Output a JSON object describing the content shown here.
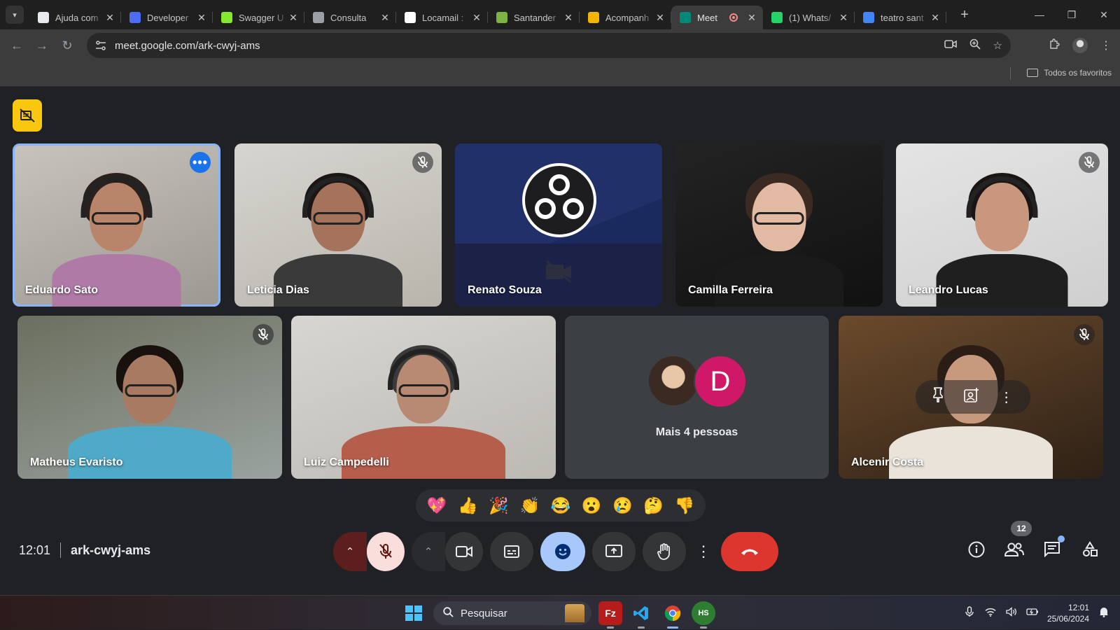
{
  "browser": {
    "tabs": [
      {
        "label": "Ajuda com",
        "favicon": "openai-icon",
        "color": "#e8eaed"
      },
      {
        "label": "Developer",
        "favicon": "developer-icon",
        "color": "#4a6cf7"
      },
      {
        "label": "Swagger U",
        "favicon": "swagger-icon",
        "color": "#85ea2d"
      },
      {
        "label": "Consulta",
        "favicon": "globe-icon",
        "color": "#9aa0a6"
      },
      {
        "label": "Locamail :",
        "favicon": "w-icon",
        "color": "#ffffff"
      },
      {
        "label": "Santander",
        "favicon": "santander-icon",
        "color": "#7cb342"
      },
      {
        "label": "Acompanh",
        "favicon": "crown-icon",
        "color": "#f4b400"
      },
      {
        "label": "Meet",
        "favicon": "meet-icon",
        "color": "#00897b",
        "active": true
      },
      {
        "label": "(1) Whats/",
        "favicon": "whatsapp-icon",
        "color": "#25d366"
      },
      {
        "label": "teatro sant",
        "favicon": "google-icon",
        "color": "#4285f4"
      }
    ],
    "url": "meet.google.com/ark-cwyj-ams",
    "bookmarks_all": "Todos os favoritos"
  },
  "meet": {
    "participants": [
      {
        "name": "Eduardo Sato",
        "muted": false,
        "speaking": true,
        "bg": [
          "#c8c4bd",
          "#9d9891"
        ],
        "skin": "#b8856a",
        "hair": "#2a211c",
        "shirt": "#b07aa6",
        "glasses": true,
        "headset": true
      },
      {
        "name": "Leticia Dias",
        "muted": true,
        "speaking": false,
        "bg": [
          "#d7d5d0",
          "#b9b5ad"
        ],
        "skin": "#a5735b",
        "hair": "#1b1514",
        "shirt": "#3a3a3a",
        "glasses": true,
        "headset": true
      },
      {
        "name": "Renato Souza",
        "muted": false,
        "speaking": false,
        "camera_off": true
      },
      {
        "name": "Camilla Ferreira",
        "muted": false,
        "speaking": false,
        "bg": [
          "#232323",
          "#111111"
        ],
        "skin": "#e2b9a2",
        "hair": "#3a2a22",
        "shirt": "#1a1a1a",
        "glasses": true,
        "headset": false
      },
      {
        "name": "Leandro Lucas",
        "muted": true,
        "speaking": false,
        "bg": [
          "#e4e4e4",
          "#cfcfcf"
        ],
        "skin": "#c9977d",
        "hair": "#1a1412",
        "shirt": "#1f1f1f",
        "glasses": false,
        "headset": true
      },
      {
        "name": "Matheus Evaristo",
        "muted": true,
        "speaking": false,
        "bg": [
          "#6b6f5e",
          "#9aa3a0"
        ],
        "skin": "#a97a62",
        "hair": "#18110e",
        "shirt": "#4fa9c8",
        "glasses": true,
        "headset": false
      },
      {
        "name": "Luiz Campedelli",
        "muted": false,
        "speaking": false,
        "bg": [
          "#d8d6d2",
          "#bcb9b3"
        ],
        "skin": "#b98a73",
        "hair": "#3a3a3a",
        "shirt": "#b65e4c",
        "glasses": true,
        "headset": true
      },
      {
        "name_label": "Mais 4 pessoas",
        "avatar_letter": "D"
      },
      {
        "name": "Alcenir Costa",
        "muted": true,
        "speaking": false,
        "bg": [
          "#6b4a2c",
          "#2e2116"
        ],
        "skin": "#c79a7e",
        "hair": "#2a1d15",
        "shirt": "#e9e3da",
        "glasses": false,
        "headset": false
      }
    ],
    "reactions": [
      "💖",
      "👍",
      "🎉",
      "👏",
      "😂",
      "😮",
      "😢",
      "🤔",
      "👎"
    ],
    "clock": "12:01",
    "meeting_code": "ark-cwyj-ams",
    "people_count": "12"
  },
  "taskbar": {
    "search_placeholder": "Pesquisar",
    "time": "12:01",
    "date": "25/06/2024"
  }
}
